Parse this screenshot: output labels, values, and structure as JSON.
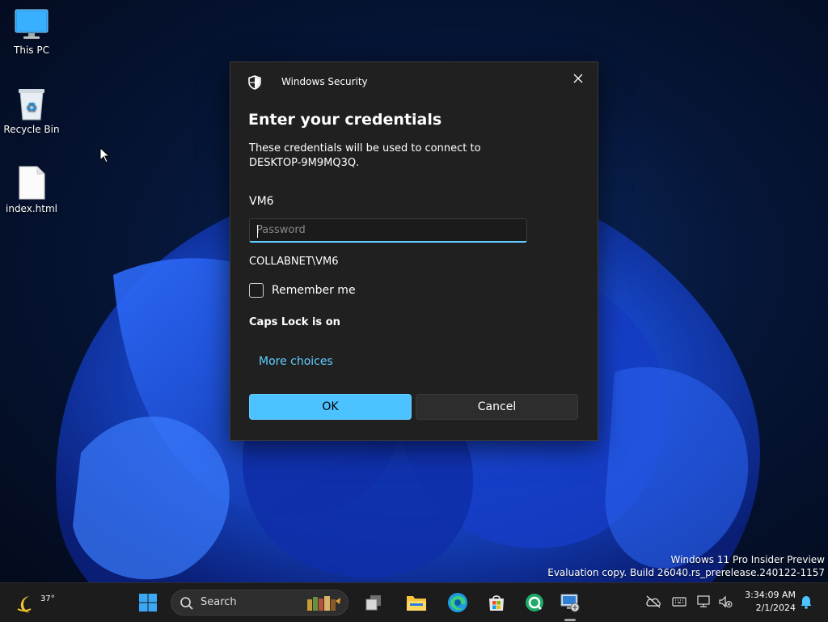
{
  "desktop": {
    "icons": [
      {
        "label": "This PC"
      },
      {
        "label": "Recycle Bin"
      },
      {
        "label": "index.html"
      }
    ],
    "watermark": {
      "line1": "Windows 11 Pro Insider Preview",
      "line2": "Evaluation copy. Build 26040.rs_prerelease.240122-1157"
    }
  },
  "dialog": {
    "app_name": "Windows Security",
    "heading": "Enter your credentials",
    "description_line1": "These credentials will be used to connect to",
    "description_line2": "DESKTOP-9M9MQ3Q.",
    "user_name": "VM6",
    "password_placeholder": "Password",
    "password_value": "",
    "domain_user": "COLLABNET\\VM6",
    "remember_label": "Remember me",
    "remember_checked": false,
    "caps_lock_warning": "Caps Lock is on",
    "more_choices": "More choices",
    "ok_label": "OK",
    "cancel_label": "Cancel",
    "accent_color": "#4cc2ff",
    "link_color": "#60cdff"
  },
  "taskbar": {
    "weather_temp": "37°",
    "search_label": "Search",
    "apps": [
      "start-icon",
      "task-view-icon",
      "file-explorer-icon",
      "edge-icon",
      "store-icon",
      "app-icon",
      "remote-desktop-icon"
    ],
    "clock_time": "3:34:09 AM",
    "clock_date": "2/1/2024"
  }
}
